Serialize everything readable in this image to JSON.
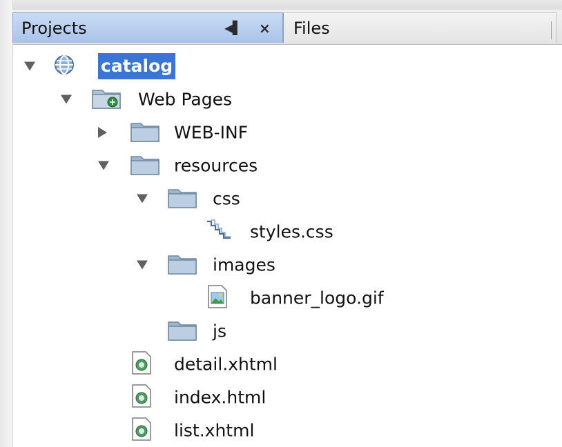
{
  "tabs": {
    "projects_label": "Projects",
    "files_label": "Files"
  },
  "tree": {
    "catalog": "catalog",
    "web_pages": "Web Pages",
    "web_inf": "WEB-INF",
    "resources": "resources",
    "css": "css",
    "styles_css": "styles.css",
    "images": "images",
    "banner_logo": "banner_logo.gif",
    "js": "js",
    "detail": "detail.xhtml",
    "index": "index.html",
    "list": "list.xhtml"
  },
  "colors": {
    "selection": "#3875d7",
    "active_tab": "#b5cdee",
    "folder": "#9fb6cf"
  },
  "icons": {
    "project": "globe-icon",
    "web_pages": "web-folder-icon",
    "folder": "folder-icon",
    "css_file": "css-file-icon",
    "image_file": "image-file-icon",
    "page_file": "xhtml-file-icon"
  }
}
